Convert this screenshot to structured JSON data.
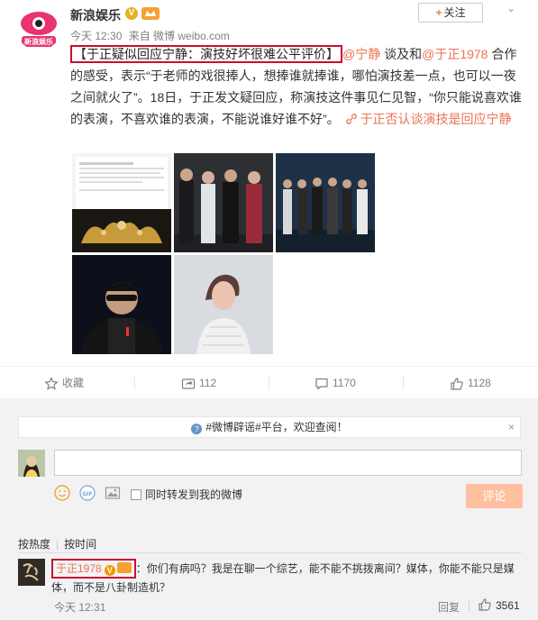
{
  "post": {
    "username": "新浪娱乐",
    "verified_badge": "V",
    "follow_label": "关注",
    "follow_plus": "+",
    "chevron": "⌄",
    "meta_time": "今天 12:30",
    "meta_from": "来自 微博 weibo.com",
    "headline_open": "【",
    "headline": "于正疑似回应宁静：演技好坏很难公平评价",
    "headline_close": "】",
    "mention_ningjing": "@宁静",
    "text_1": " 谈及和",
    "mention_yuzheng": "@于正1978",
    "text_2": " 合作的感受，表示“于老师的戏很捧人，想捧谁就捧谁，哪怕演技差一点，也可以一夜之间就火了”。18日，于正发文疑回应，称演技这件事见仁见智，“你只能说喜欢谁的表演，不喜欢谁的表演，不能说谁好谁不好”。",
    "topic_link": "于正否认谈演技是回应宁静",
    "avatar_logo_text": "新浪娱乐"
  },
  "actions": {
    "favorite": "收藏",
    "forward_count": "112",
    "comment_count": "1170",
    "like_count": "1128"
  },
  "comments_area": {
    "notice": "#微博辟谣#平台，欢迎查阅！",
    "notice_close": "×",
    "notice_icon": "?",
    "sync_forward_label": "同时转发到我的微博",
    "submit_label": "评论",
    "sort_hot": "按热度",
    "sort_time": "按时间",
    "sort_sep": "|",
    "gif_label": "GIF"
  },
  "comment": {
    "name": "于正1978",
    "v_badge": "V",
    "colon": "：",
    "text": "你们有病吗？我是在聊一个综艺，能不能不挑拨离间？媒体，你能不能只是媒体，而不是八卦制造机？",
    "time": "今天 12:31",
    "reply_label": "回复",
    "like_count": "3561"
  },
  "colors": {
    "accent": "#eb7350",
    "highlight_border": "#c8102e",
    "button_disabled": "#ffc09f",
    "background": "#f2f2f5"
  }
}
